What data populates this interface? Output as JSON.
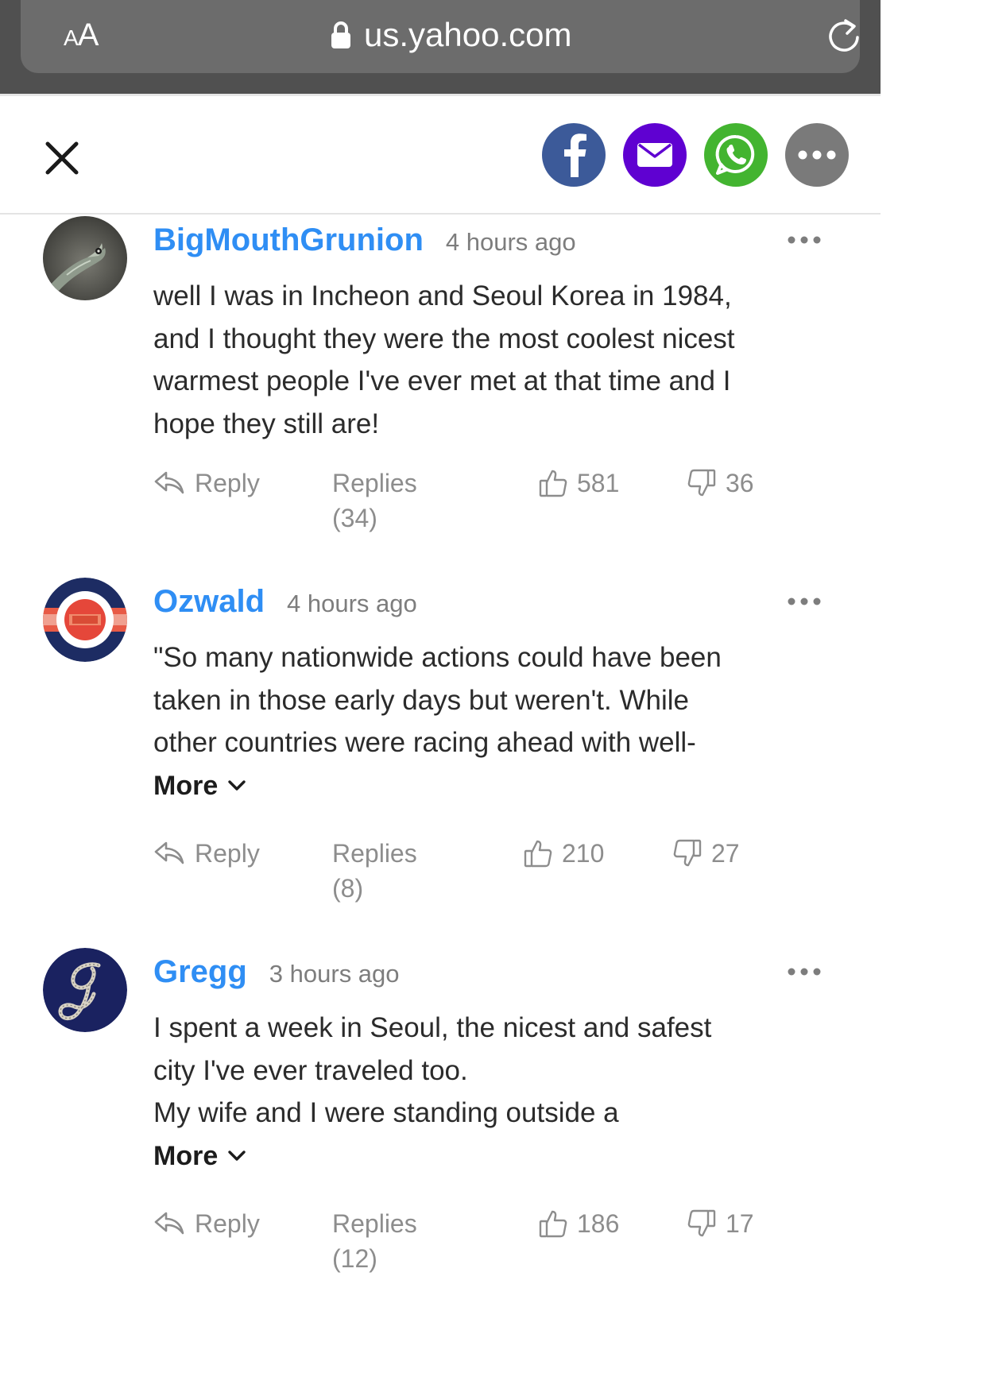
{
  "browser": {
    "aa_label_small": "A",
    "aa_label_large": "A",
    "url": "us.yahoo.com"
  },
  "share": {
    "close_icon": "close-icon",
    "buttons": [
      "facebook-icon",
      "email-icon",
      "whatsapp-icon",
      "more-icon"
    ],
    "colors": {
      "facebook": "#3c5a99",
      "email": "#5f01d1",
      "whatsapp": "#43b430",
      "more": "#7a7a7a"
    }
  },
  "accent_color": "#2f8ef4",
  "comments": [
    {
      "username": "BigMouthGrunion",
      "time": "4 hours ago",
      "lines": [
        "well I was in Incheon and Seoul Korea in 1984,",
        "and I thought they were the most coolest nicest",
        "warmest people I've ever met at that time and I",
        "hope they still are!"
      ],
      "more": "",
      "reply": "Reply",
      "replies": "Replies (34)",
      "likes": "581",
      "dislikes": "36"
    },
    {
      "username": "Ozwald",
      "time": "4 hours ago",
      "lines": [
        "\"So many nationwide actions could have been",
        "taken in those early days but weren't. While",
        "other countries were racing ahead with well-"
      ],
      "more": "More",
      "reply": "Reply",
      "replies": "Replies (8)",
      "likes": "210",
      "dislikes": "27"
    },
    {
      "username": "Gregg",
      "time": "3 hours ago",
      "lines": [
        "I spent a week in Seoul, the nicest and safest",
        "city I've ever traveled too.",
        "My wife and I were standing outside a"
      ],
      "more": "More",
      "reply": "Reply",
      "replies": "Replies (12)",
      "likes": "186",
      "dislikes": "17"
    }
  ]
}
